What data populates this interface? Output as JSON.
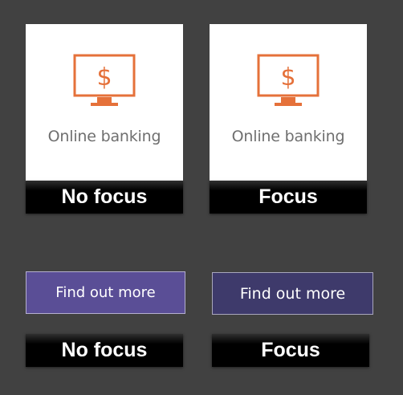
{
  "cards": [
    {
      "label": "Online banking",
      "icon": "monitor-dollar-icon",
      "state_caption": "No focus"
    },
    {
      "label": "Online banking",
      "icon": "monitor-dollar-icon",
      "state_caption": "Focus"
    }
  ],
  "buttons": [
    {
      "label": "Find out more",
      "state_caption": "No focus"
    },
    {
      "label": "Find out more",
      "state_caption": "Focus"
    }
  ],
  "colors": {
    "background": "#414141",
    "icon_orange": "#e5713a",
    "button_default": "#5a4e96",
    "button_focus": "#3e3a6b",
    "caption_bg": "#000000"
  }
}
